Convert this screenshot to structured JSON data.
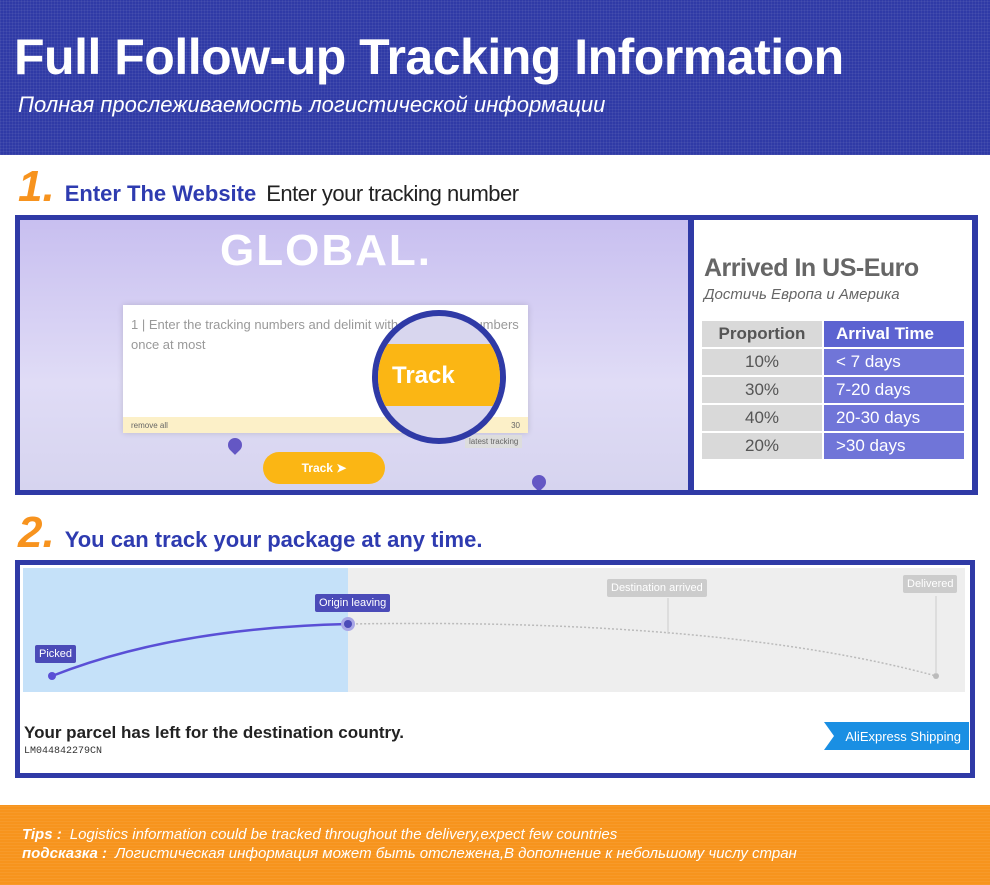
{
  "header": {
    "title": "Full Follow-up Tracking Information",
    "subtitle": "Полная прослеживаемость логистической информации"
  },
  "step1": {
    "number": "1.",
    "title": "Enter The Website",
    "desc": "Enter your tracking number"
  },
  "website": {
    "logo": "GLOBAL.",
    "input_line": "1",
    "placeholder": "Enter the tracking numbers and delimit with a return 30 numbers once at most",
    "remove_all": "remove all",
    "count": "30",
    "track_label": "Track",
    "latest_tracking": "latest tracking"
  },
  "arrival": {
    "title": "Arrived In US-Euro",
    "subtitle": "Достичь Европа и Америка",
    "headers": [
      "Proportion",
      "Arrival Time"
    ],
    "rows": [
      {
        "p": "10%",
        "t": "< 7 days"
      },
      {
        "p": "30%",
        "t": "7-20 days"
      },
      {
        "p": "40%",
        "t": "20-30 days"
      },
      {
        "p": "20%",
        "t": ">30 days"
      }
    ]
  },
  "step2": {
    "number": "2.",
    "title": "You can track your package at any time."
  },
  "tracking": {
    "stages": [
      "Picked",
      "Origin leaving",
      "Destination arrived",
      "Delivered"
    ],
    "status": "Your parcel has left for the destination country.",
    "number": "LM044842279CN",
    "carrier": "AliExpress Shipping"
  },
  "footer": {
    "tips_label": "Tips :",
    "tips": "Logistics information could be tracked throughout the delivery,expect few countries",
    "ru_label": "подсказка :",
    "ru": "Логистическая информация может быть отслежена,В дополнение к небольшому числу стран"
  },
  "colors": {
    "brand_blue": "#2f3aa6",
    "accent_orange": "#f7941d",
    "track_yellow": "#fbb614"
  }
}
